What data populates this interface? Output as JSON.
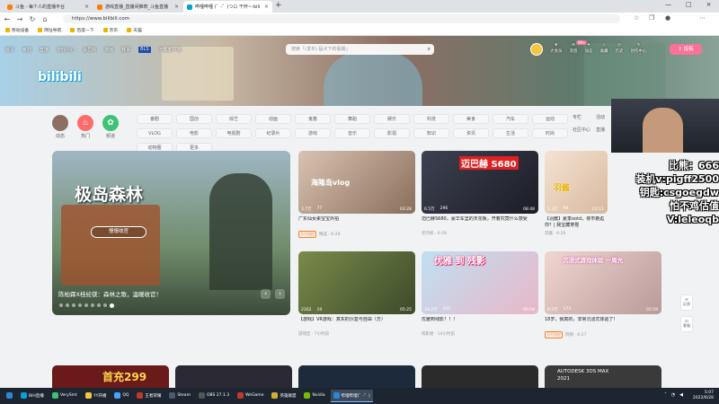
{
  "browser": {
    "tabs": [
      {
        "title": "斗鱼 - 每个人的直播平台",
        "color": "#ff7d00",
        "active": false
      },
      {
        "title": "游戏直播_直播间推荐_斗鱼直播",
        "color": "#ff7d00",
        "active": false
      },
      {
        "title": "哔哩哔哩 (゜-゜)つロ 干杯~-bili",
        "color": "#00a1d6",
        "active": true
      }
    ],
    "new_tab": "+",
    "url": "https://www.bilibili.com",
    "bookmarks": [
      "移动设备",
      "网址导航",
      "百度一下",
      "京东",
      "天猫"
    ]
  },
  "header": {
    "logo": "bilibili",
    "nav": [
      "首页",
      "番剧",
      "直播",
      "游戏中心",
      "会员购",
      "漫画",
      "赛事",
      "BLS",
      "下载客户端"
    ],
    "search_placeholder": "搜索「(发布) 猛犬下的假期」",
    "right_nav": [
      "大会员",
      "消息",
      "动态",
      "收藏",
      "历史",
      "创作中心"
    ],
    "upload": "投稿",
    "badge": "99+"
  },
  "quick_links": [
    {
      "label": "动态",
      "color": "#8d6e63"
    },
    {
      "label": "热门",
      "color": "#ff6b6b"
    },
    {
      "label": "频道",
      "color": "#3fc176"
    }
  ],
  "channels": [
    "番剧",
    "国创",
    "综艺",
    "动画",
    "鬼畜",
    "舞蹈",
    "娱乐",
    "科技",
    "美食",
    "汽车",
    "运动",
    "VLOG",
    "电影",
    "电视剧",
    "纪录片",
    "游戏",
    "音乐",
    "影视",
    "知识",
    "资讯",
    "生活",
    "时尚",
    "动物圈",
    "更多"
  ],
  "side_channels": [
    "专栏",
    "活动",
    "社区中心",
    "直播"
  ],
  "carousel": {
    "title": "极岛森林",
    "button": "慢慢收官",
    "caption": "陈柏霖X桂纶镁：森林之歌，温暖收官！",
    "prev": "‹",
    "next": "›"
  },
  "videos": [
    {
      "title": "广东仙女柔宝宝外拍",
      "stat1": "3.7万",
      "stat2": "77",
      "dur": "03:28",
      "tag": "万千回应",
      "meta": "精选 · 6-20",
      "color": "#b59a86",
      "overlay": "海隆岛vlog"
    },
    {
      "title": "迈巴赫S680，豪华车里的天花板，开着究竟什么感受",
      "stat1": "6.5万",
      "stat2": "296",
      "dur": "08:48",
      "tag": "",
      "meta": "老司机 · 6-28",
      "color": "#2d2f3a",
      "overlay": "迈巴赫 S680"
    },
    {
      "title": "【羽酱】夏季ootd，夜市邂逅你？| 我宝藏穿搭",
      "stat1": "1.3万",
      "stat2": "94",
      "dur": "01:11",
      "tag": "",
      "meta": "羽酱 · 6-26",
      "color": "#efd8c4",
      "overlay": "羽酱"
    },
    {
      "title": "【游戏】VR游戏：真实的沙盒与自由（方）",
      "stat1": "2162",
      "stat2": "19",
      "dur": "05:25",
      "tag": "",
      "meta": "游戏区 · 7小时前",
      "color": "#5a6e3c",
      "overlay": ""
    },
    {
      "title": "优雅到残影！！！",
      "stat1": "19.2万",
      "stat2": "442",
      "dur": "00:58",
      "tag": "",
      "meta": "残影君 · 14小时前",
      "color": "#9ec8e6",
      "overlay": "优雅 到 残影"
    },
    {
      "title": "18岁，我真的，非常沉浸式体验了！",
      "stat1": "8.2万",
      "stat2": "173",
      "dur": "02:59",
      "tag": "万千回应",
      "meta": "阿朝 · 6-27",
      "color": "#e0c7c0",
      "overlay": "沉浸式游戏体验 一周光"
    }
  ],
  "row3": [
    {
      "text": "首充299",
      "color": "#6b1a1a"
    },
    {
      "text": "",
      "color": "#2a2833"
    },
    {
      "text": "",
      "color": "#1d2a3b"
    },
    {
      "text": "",
      "color": "#2b2b2b"
    },
    {
      "text": "AUTODESK 3DS MAX 2021",
      "color": "#3a3a3a"
    }
  ],
  "stream_overlay": [
    "比熊：666",
    "装机v:pigff2500",
    "钥匙:csgoegdw",
    "怕不鸡估值V:leleoqb"
  ],
  "side_float": [
    "反馈",
    "客服"
  ],
  "taskbar": {
    "items": [
      {
        "label": "",
        "color": "#2b88d8"
      },
      {
        "label": "BIH直播",
        "color": "#00a1d6"
      },
      {
        "label": "VerySmt",
        "color": "#3fc176"
      },
      {
        "label": "YY开播",
        "color": "#f5c542"
      },
      {
        "label": "QQ",
        "color": "#4aa1ff"
      },
      {
        "label": "王者荣耀",
        "color": "#c0392b"
      },
      {
        "label": "Steam",
        "color": "#1b2838"
      },
      {
        "label": "OBS 27.1.3",
        "color": "#302e31"
      },
      {
        "label": "WeGame",
        "color": "#c0392b"
      },
      {
        "label": "英雄联盟",
        "color": "#d4af37"
      },
      {
        "label": "Nvidia",
        "color": "#76b900"
      },
      {
        "label": "哔哩哔哩(゜-゜)",
        "color": "#2b88d8"
      }
    ],
    "time": "5:07",
    "date": "2022/6/28"
  }
}
